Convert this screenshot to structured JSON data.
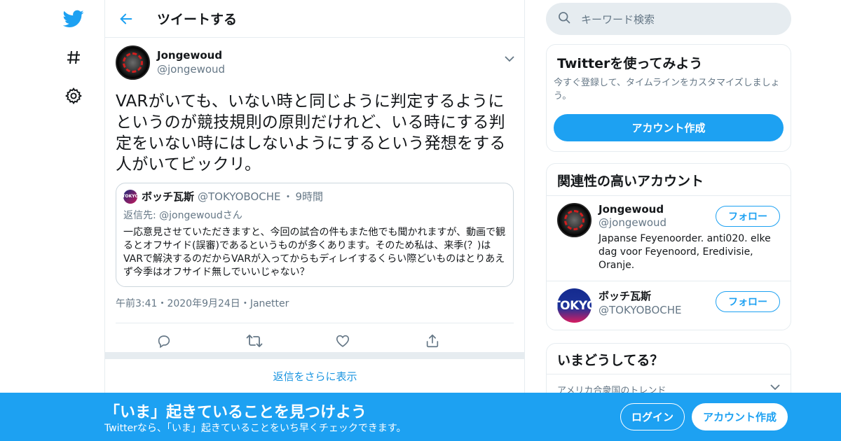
{
  "header": {
    "title": "ツイートする"
  },
  "tweet": {
    "author_name": "Jongewoud",
    "author_handle": "@jongewoud",
    "text": "VARがいても、いない時と同じように判定するようにというのが競技規則の原則だけれど、いる時にする判定をいない時にはしないようにするという発想をする人がいてビックリ。",
    "quote": {
      "avatar_text": "TOKYO",
      "name": "ボッチ瓦斯",
      "handle": "@TOKYOBOCHE",
      "dot": "・",
      "time": "9時間",
      "reply_to": "返信先: @jongewoudさん",
      "text": "一応意見させていただきますと、今回の試合の件もまた他でも聞かれますが、動画で観るとオフサイド(誤審)であるというものが多くあります。そのため私は、来季(？)はVARで解決するのだからVARが入ってからもディレイするくらい際どいものはとりあえず今季はオフサイド無しでいいじゃない？"
    },
    "time": "午前3:41",
    "dot": "・",
    "date": "2020年9月24日",
    "source": "Janetter"
  },
  "more_replies": "返信をさらに表示",
  "sidebar": {
    "search_placeholder": "キーワード検索",
    "signup_card": {
      "title": "Twitterを使ってみよう",
      "description": "今すぐ登録して、タイムラインをカスタマイズしましょう。",
      "button": "アカウント作成"
    },
    "related": {
      "title": "関連性の高いアカウント",
      "accounts": [
        {
          "name": "Jongewoud",
          "handle": "@jongewoud",
          "bio": "Japanse Feyenoorder. anti020. elke dag voor Feyenoord, Eredivisie, Oranje.",
          "follow": "フォロー"
        },
        {
          "name": "ボッチ瓦斯",
          "handle": "@TOKYOBOCHE",
          "bio": "",
          "follow": "フォロー",
          "avatar_text": "TOKYO"
        }
      ]
    },
    "trends": {
      "title": "いまどうしてる？",
      "location": "アメリカ合衆国のトレンド"
    }
  },
  "banner": {
    "title": "「いま」起きていることを見つけよう",
    "subtitle": "Twitterなら、「いま」起きていることをいち早くチェックできます。",
    "login": "ログイン",
    "signup": "アカウント作成"
  },
  "colors": {
    "accent": "#1da1f2",
    "secondary_text": "#657786",
    "border": "#e6ecf0"
  },
  "icons": [
    "twitter-bird-icon",
    "hashtag-icon",
    "gear-icon",
    "back-arrow-icon",
    "chevron-down-icon",
    "reply-icon",
    "retweet-icon",
    "like-icon",
    "share-icon",
    "search-icon"
  ]
}
